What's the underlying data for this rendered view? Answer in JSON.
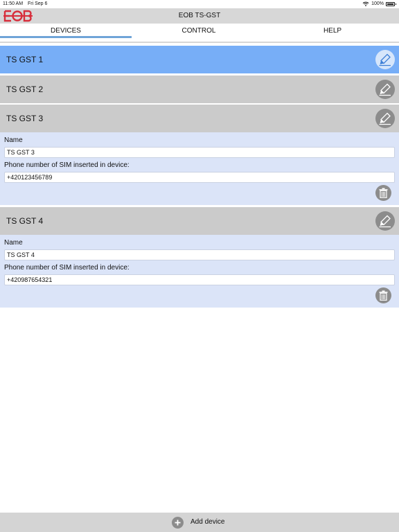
{
  "status_bar": {
    "time": "11:50 AM",
    "date": "Fri Sep 6",
    "battery": "100%"
  },
  "app": {
    "title": "EOB TS-GST",
    "logo_text": "EOB",
    "logo_color": "#d72d3b"
  },
  "tabs": [
    {
      "label": "DEVICES",
      "selected": true
    },
    {
      "label": "CONTROL",
      "selected": false
    },
    {
      "label": "HELP",
      "selected": false
    }
  ],
  "devices": [
    {
      "name": "TS GST 1",
      "state": "selected"
    },
    {
      "name": "TS GST 2",
      "state": "collapsed"
    },
    {
      "name": "TS GST 3",
      "state": "expanded",
      "name_label": "Name",
      "name_value": "TS GST 3",
      "phone_label": "Phone number of SIM inserted in device:",
      "phone_value": "+420123456789"
    },
    {
      "name": "TS GST 4",
      "state": "expanded",
      "name_label": "Name",
      "name_value": "TS GST 4",
      "phone_label": "Phone number of SIM inserted in device:",
      "phone_value": "+420987654321"
    }
  ],
  "icons": {
    "edit": "pencil-icon",
    "delete": "trash-icon",
    "add": "plus-circle-icon",
    "wifi": "wifi-icon",
    "battery": "battery-icon"
  },
  "colors": {
    "selected_row": "#77aef7",
    "row": "#cbcbcb",
    "panel": "#dbe4f8",
    "tab_indicator": "#6fa4d8",
    "icon_circle": "#8c8c8c"
  },
  "footer": {
    "add_label": "Add device"
  }
}
